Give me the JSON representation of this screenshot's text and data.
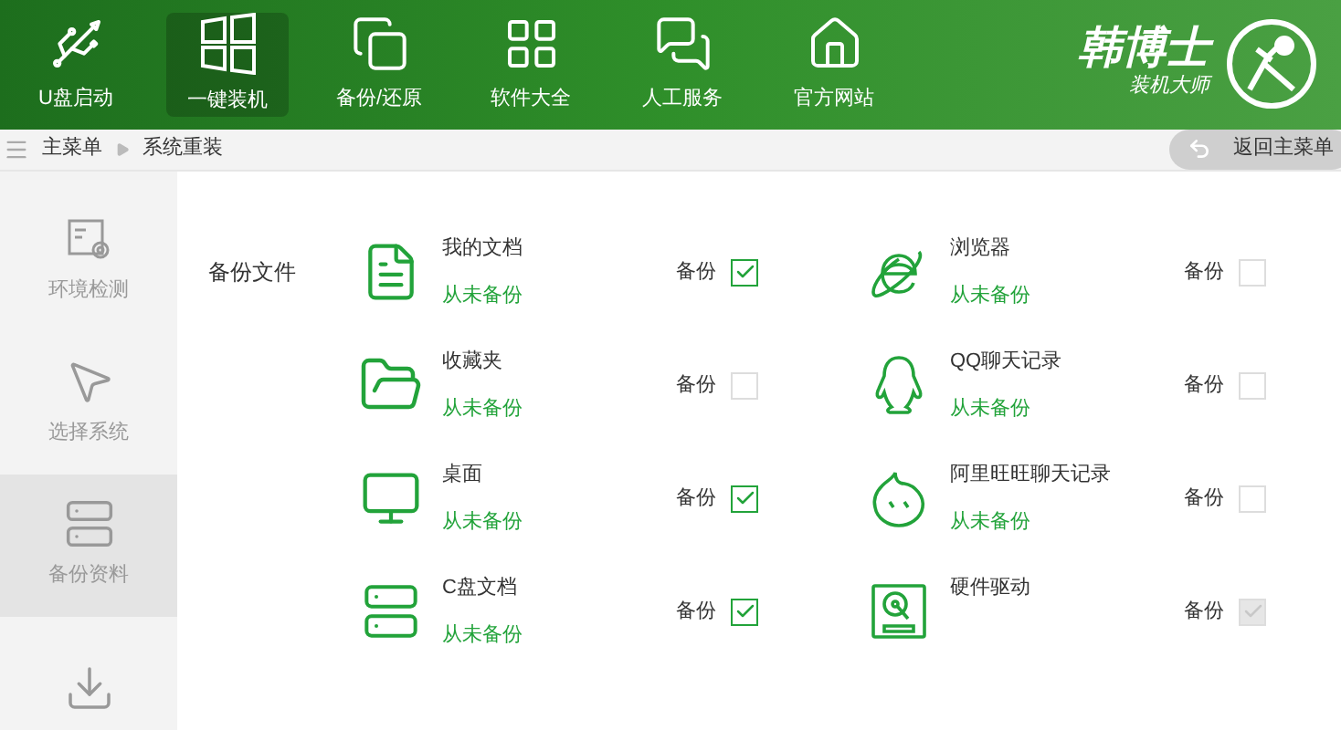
{
  "header": {
    "nav": [
      {
        "label": "U盘启动",
        "selected": false
      },
      {
        "label": "一键装机",
        "selected": true
      },
      {
        "label": "备份/还原",
        "selected": false
      },
      {
        "label": "软件大全",
        "selected": false
      },
      {
        "label": "人工服务",
        "selected": false
      },
      {
        "label": "官方网站",
        "selected": false
      }
    ],
    "logo": {
      "title": "韩博士",
      "subtitle": "装机大师"
    }
  },
  "breadcrumb": [
    "主菜单",
    "系统重装"
  ],
  "back_button": "返回主菜单",
  "sidebar": {
    "items": [
      {
        "label": "环境检测",
        "selected": false
      },
      {
        "label": "选择系统",
        "selected": false
      },
      {
        "label": "备份资料",
        "selected": true
      },
      {
        "selected": false
      }
    ]
  },
  "backup": {
    "section_label": "备份文件",
    "items": [
      {
        "name": "我的文档",
        "status": "从未备份",
        "checkbox_label": "备份",
        "checked": true,
        "disabled": false
      },
      {
        "name": "浏览器",
        "status": "从未备份",
        "checkbox_label": "备份",
        "checked": false,
        "disabled": false
      },
      {
        "name": "收藏夹",
        "status": "从未备份",
        "checkbox_label": "备份",
        "checked": false,
        "disabled": false
      },
      {
        "name": "QQ聊天记录",
        "status": "从未备份",
        "checkbox_label": "备份",
        "checked": false,
        "disabled": false
      },
      {
        "name": "桌面",
        "status": "从未备份",
        "checkbox_label": "备份",
        "checked": true,
        "disabled": false
      },
      {
        "name": "阿里旺旺聊天记录",
        "status": "从未备份",
        "checkbox_label": "备份",
        "checked": false,
        "disabled": false
      },
      {
        "name": "C盘文档",
        "status": "从未备份",
        "checkbox_label": "备份",
        "checked": true,
        "disabled": false
      },
      {
        "name": "硬件驱动",
        "checkbox_label": "备份",
        "checked": true,
        "disabled": true
      }
    ]
  }
}
